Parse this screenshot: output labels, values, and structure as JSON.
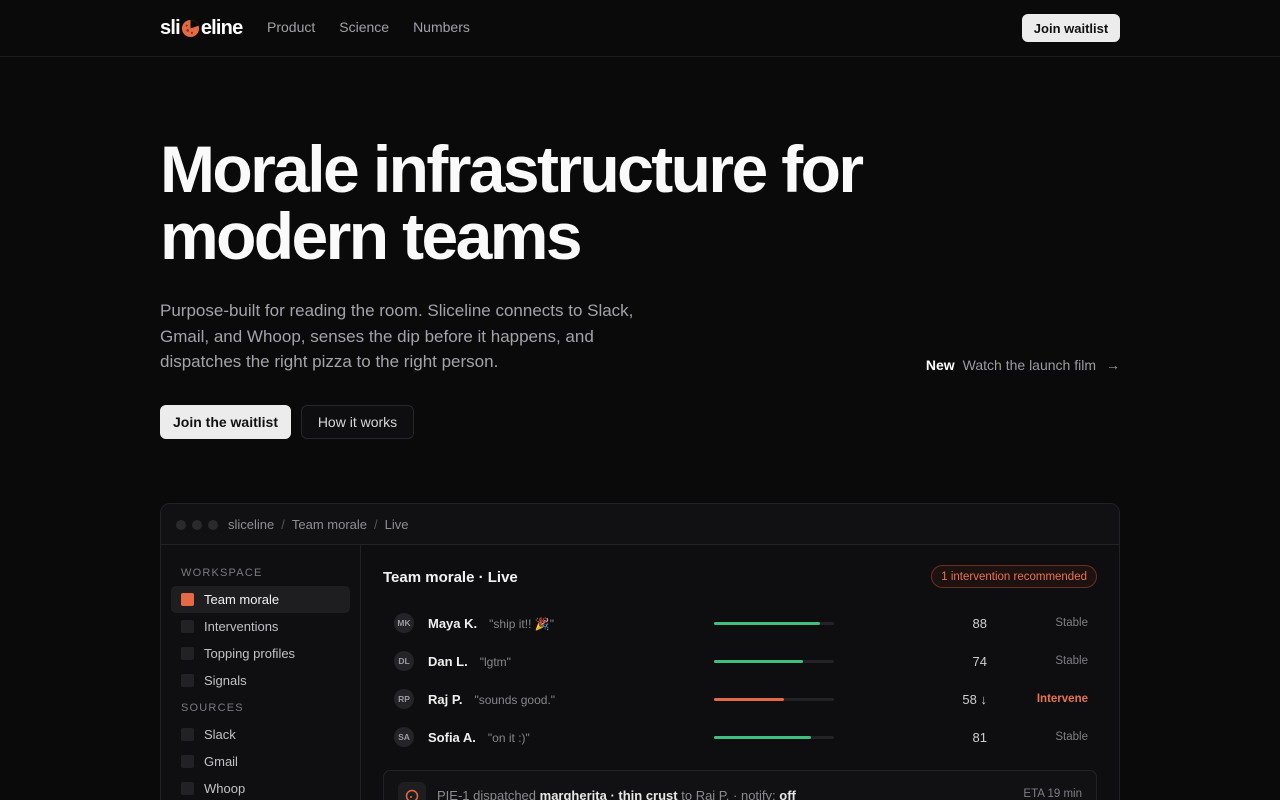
{
  "nav": {
    "logo_left": "sli",
    "logo_right": "eline",
    "links": [
      "Product",
      "Science",
      "Numbers"
    ],
    "cta": "Join waitlist"
  },
  "hero": {
    "title": "Morale infrastructure for modern teams",
    "subtitle": "Purpose-built for reading the room. Sliceline connects to Slack, Gmail, and Whoop, senses the dip before it happens, and dispatches the right pizza to the right person.",
    "primary_cta": "Join the waitlist",
    "secondary_cta": "How it works",
    "film_badge": "New",
    "film_label": "Watch the launch film",
    "film_arrow": "→"
  },
  "app": {
    "breadcrumb": [
      "sliceline",
      "Team morale",
      "Live"
    ],
    "breadcrumb_sep": "/",
    "sidebar": {
      "workspace_heading": "WORKSPACE",
      "workspace_items": [
        "Team morale",
        "Interventions",
        "Topping profiles",
        "Signals"
      ],
      "sources_heading": "SOURCES",
      "source_items": [
        "Slack",
        "Gmail",
        "Whoop"
      ]
    },
    "main": {
      "title": "Team morale · Live",
      "alert": "1 intervention recommended",
      "rows": [
        {
          "initials": "MK",
          "name": "Maya K.",
          "quote": "\"ship it!! 🎉\"",
          "score": "88",
          "level": 0.88,
          "status": "Stable",
          "warn": false
        },
        {
          "initials": "DL",
          "name": "Dan L.",
          "quote": "\"lgtm\"",
          "score": "74",
          "level": 0.74,
          "status": "Stable",
          "warn": false
        },
        {
          "initials": "RP",
          "name": "Raj P.",
          "quote": "\"sounds good.\"",
          "score": "58 ↓",
          "level": 0.58,
          "status": "Intervene",
          "warn": true
        },
        {
          "initials": "SA",
          "name": "Sofia A.",
          "quote": "\"on it :)\"",
          "score": "81",
          "level": 0.81,
          "status": "Stable",
          "warn": false
        }
      ],
      "dispatch": {
        "prefix": "PIE-1 dispatched",
        "pizza": "margherita · thin crust",
        "to": "to Raj P. · notify:",
        "notify": "off",
        "eta": "ETA 19 min"
      }
    }
  },
  "colors": {
    "accent": "#e36a44",
    "ok": "#3fbf7f",
    "background": "#0a0a0b"
  }
}
